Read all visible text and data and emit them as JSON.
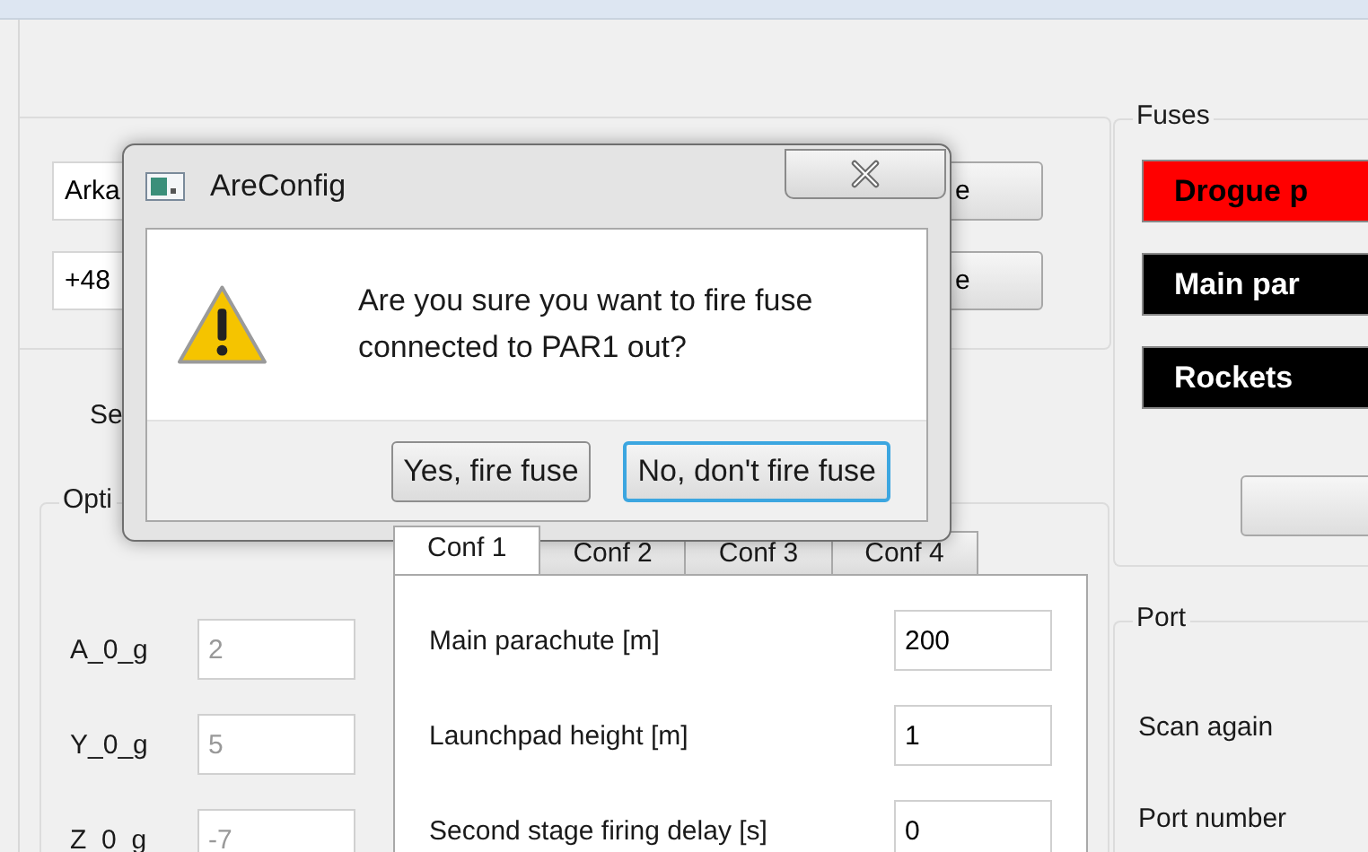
{
  "contact_fields": [
    {
      "value": "Arka",
      "button": "e"
    },
    {
      "value": "+48",
      "button": "e"
    }
  ],
  "section_label": "Se",
  "options": {
    "title": "Opti",
    "axes": [
      {
        "label": "A_0_g",
        "value": "2",
        "disabled": true
      },
      {
        "label": "Y_0_g",
        "value": "5",
        "disabled": true
      },
      {
        "label": "Z_0_g",
        "value": "-7",
        "disabled": true
      }
    ],
    "tabs": [
      {
        "label": "Conf 1",
        "selected": true
      },
      {
        "label": "Conf 2",
        "selected": false
      },
      {
        "label": "Conf 3",
        "selected": false
      },
      {
        "label": "Conf 4",
        "selected": false
      }
    ],
    "settings": [
      {
        "label": "Main parachute [m]",
        "value": "200"
      },
      {
        "label": "Launchpad height [m]",
        "value": "1"
      },
      {
        "label": "Second stage firing delay [s]",
        "value": "0"
      }
    ]
  },
  "fuses": {
    "title": "Fuses",
    "items": [
      {
        "label": "Drogue p",
        "color": "#ff0000"
      },
      {
        "label": "Main par",
        "color": "#000000"
      },
      {
        "label": "Rockets",
        "color": "#000000"
      }
    ]
  },
  "port": {
    "title": "Port",
    "scan_label": "Scan again",
    "port_label": "Port number"
  },
  "dialog": {
    "title": "AreConfig",
    "message": "Are you sure you want to fire fuse connected to PAR1 out?",
    "buttons": [
      {
        "label": "Yes, fire fuse",
        "focused": false
      },
      {
        "label": "No, don't fire fuse",
        "focused": true
      }
    ]
  }
}
